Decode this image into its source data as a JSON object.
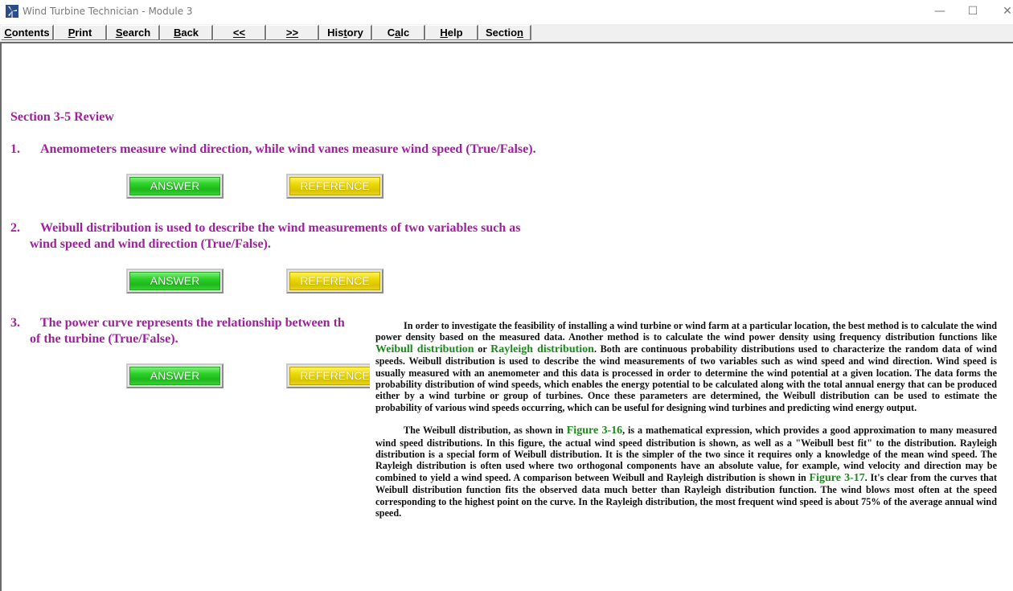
{
  "window": {
    "title": "Wind Turbine Technician - Module 3",
    "controls": {
      "minimize": "—",
      "maximize": "☐",
      "close": "✕"
    }
  },
  "toolbar": {
    "buttons": [
      {
        "label": "Contents",
        "accel": "C",
        "rest": "ontents"
      },
      {
        "label": "Print",
        "accel": "P",
        "rest": "rint"
      },
      {
        "label": "Search",
        "accel": "S",
        "rest": "earch"
      },
      {
        "label": "Back",
        "accel": "B",
        "rest": "ack"
      },
      {
        "label": "<<",
        "accel": "<<",
        "rest": ""
      },
      {
        "label": ">>",
        "accel": ">>",
        "rest": ""
      },
      {
        "label": "History",
        "pre": "His",
        "accel": "t",
        "rest": "ory"
      },
      {
        "label": "Calc",
        "pre": "C",
        "accel": "a",
        "rest": "lc"
      },
      {
        "label": "Help",
        "accel": "H",
        "rest": "elp"
      },
      {
        "label": "Section",
        "pre": "Sectio",
        "accel": "n",
        "rest": ""
      }
    ]
  },
  "main": {
    "section_title": "Section 3-5 Review",
    "questions": [
      {
        "number": "1.",
        "text": "Anemometers measure wind direction, while wind vanes measure wind speed (True/False).",
        "line2": ""
      },
      {
        "number": "2.",
        "text": "Weibull distribution is used to describe the wind measurements of two variables such as",
        "line2": "wind speed and wind direction (True/False)."
      },
      {
        "number": "3.",
        "text": "The power curve represents the relationship between th",
        "line2": "of the turbine (True/False)."
      }
    ],
    "answer_label": "ANSWER",
    "reference_label": "REFERENCE"
  },
  "popup": {
    "p1": {
      "a": "In order to investigate the feasibility of installing a wind turbine or wind farm at a particular location, the best method is to calculate the wind power density based on the measured data. Another method is to calculate the wind power density using frequency distribution functions like ",
      "link1": "Weibull distribution",
      "b": " or ",
      "link2": "Rayleigh distribution",
      "c": ". Both are continuous probability distributions used to characterize the random data of wind speeds. Weibull distribution is used to describe the wind measurements of two variables such as wind speed and wind direction. Wind speed is usually measured with an anemometer and this data is processed in order to determine the wind potential at a given location. The data forms the probability distribution of wind speeds, which enables the energy potential to be calculated along with the total annual energy that can be produced either by a wind turbine or group of turbines. Once these parameters are determined, the Weibull distribution can be used to estimate the probability of various wind speeds occurring, which can be useful for designing wind turbines and predicting wind energy output."
    },
    "p2": {
      "a": "The Weibull distribution, as shown in ",
      "link1": "Figure 3-16",
      "b": ", is a mathematical expression, which provides a good approximation to many measured wind speed distributions. In this figure, the actual wind speed distribution is shown, as well as a \"Weibull best fit\" to the distribution. Rayleigh distribution is a special form of Weibull distribution. It is the simpler of the two since it requires only a knowledge of the mean wind speed. The Rayleigh distribution is often used where two orthogonal components have an absolute value, for example, wind velocity and direction may be combined to yield a wind speed. A comparison between Weibull and Rayleigh distribution is shown in ",
      "link2": "Figure 3-17",
      "c": ". It's clear from the curves that Weibull distribution function fits the observed data much better than Rayleigh distribution function. The wind blows most often at the speed corresponding to the highest point on the curve. In the Rayleigh distribution, the most frequent wind speed is about 75% of the average annual wind speed."
    }
  }
}
